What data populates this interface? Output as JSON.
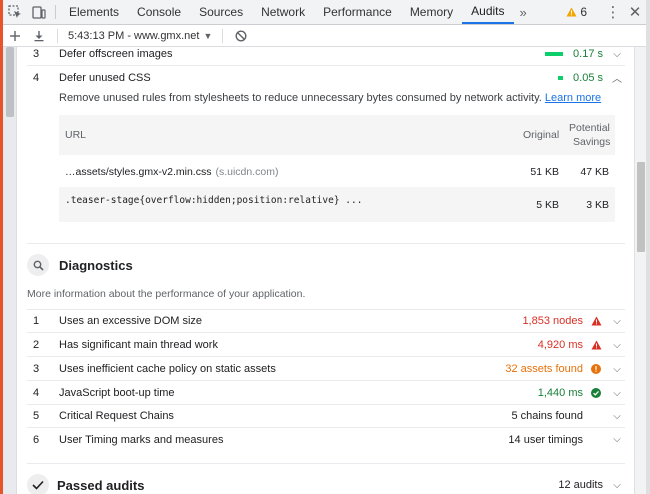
{
  "colors": {
    "red": "#d93025",
    "orange": "#e8710a",
    "green": "#188038",
    "link": "#1a73e8"
  },
  "tabs": [
    {
      "label": "Elements"
    },
    {
      "label": "Console"
    },
    {
      "label": "Sources"
    },
    {
      "label": "Network"
    },
    {
      "label": "Performance"
    },
    {
      "label": "Memory"
    },
    {
      "label": "Audits"
    }
  ],
  "tab_more": "»",
  "warnings_count": "6",
  "session_label": "5:43:13 PM - www.gmx.net",
  "opportunities": [
    {
      "num": "3",
      "title": "Defer offscreen images",
      "value": "0.17 s",
      "bar_fraction": 1.0
    },
    {
      "num": "4",
      "title": "Defer unused CSS",
      "value": "0.05 s",
      "bar_fraction": 0.25
    }
  ],
  "unused_css": {
    "description": "Remove unused rules from stylesheets to reduce unnecessary bytes consumed by network activity.",
    "learn_more": "Learn more",
    "headers": {
      "url": "URL",
      "original": "Original",
      "potential": "Potential",
      "savings": "Savings"
    },
    "rows": [
      {
        "url": "…assets/styles.gmx-v2.min.css",
        "host": "(s.uicdn.com)",
        "original": "51 KB",
        "savings": "47 KB"
      },
      {
        "url": ".teaser-stage{overflow:hidden;position:relative} ...",
        "original": "5 KB",
        "savings": "3 KB"
      }
    ]
  },
  "diagnostics": {
    "title": "Diagnostics",
    "description": "More information about the performance of your application.",
    "items": [
      {
        "num": "1",
        "title": "Uses an excessive DOM size",
        "value": "1,853 nodes",
        "status": "fail"
      },
      {
        "num": "2",
        "title": "Has significant main thread work",
        "value": "4,920 ms",
        "status": "fail"
      },
      {
        "num": "3",
        "title": "Uses inefficient cache policy on static assets",
        "value": "32 assets found",
        "status": "average"
      },
      {
        "num": "4",
        "title": "JavaScript boot-up time",
        "value": "1,440 ms",
        "status": "pass"
      },
      {
        "num": "5",
        "title": "Critical Request Chains",
        "value": "5 chains found",
        "status": "info"
      },
      {
        "num": "6",
        "title": "User Timing marks and measures",
        "value": "14 user timings",
        "status": "info"
      }
    ]
  },
  "passed": {
    "title": "Passed audits",
    "count": "12 audits"
  }
}
